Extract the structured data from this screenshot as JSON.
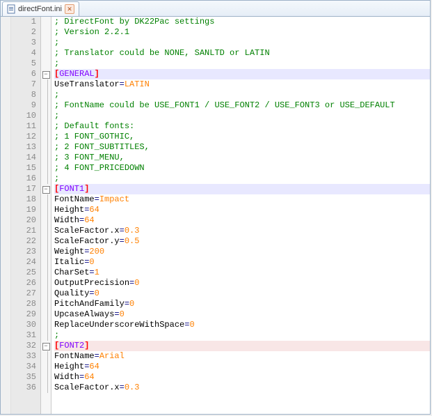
{
  "tab": {
    "filename": "directFont.ini",
    "close": "✕"
  },
  "fold": {
    "minus": "−",
    "plus": "−"
  },
  "lines": [
    {
      "n": 1,
      "f": "",
      "t": "cm",
      "txt": "; DirectFont by DK22Pac settings"
    },
    {
      "n": 2,
      "f": "",
      "t": "cm",
      "txt": "; Version 2.2.1"
    },
    {
      "n": 3,
      "f": "",
      "t": "cm",
      "txt": ";"
    },
    {
      "n": 4,
      "f": "",
      "t": "cm",
      "txt": "; Translator could be NONE, SANLTD or LATIN"
    },
    {
      "n": 5,
      "f": "",
      "t": "cm",
      "txt": ";"
    },
    {
      "n": 6,
      "f": "fold",
      "hl": "hl",
      "t": "sect",
      "open": "[",
      "name": "GENERAL",
      "close": "]"
    },
    {
      "n": 7,
      "f": "v",
      "t": "kv",
      "k": "UseTranslator",
      "v": "LATIN"
    },
    {
      "n": 8,
      "f": "v",
      "t": "cm",
      "txt": ";"
    },
    {
      "n": 9,
      "f": "v",
      "t": "cm",
      "txt": "; FontName could be USE_FONT1 / USE_FONT2 / USE_FONT3 or USE_DEFAULT"
    },
    {
      "n": 10,
      "f": "v",
      "t": "cm",
      "txt": ";"
    },
    {
      "n": 11,
      "f": "v",
      "t": "cm",
      "txt": "; Default fonts:"
    },
    {
      "n": 12,
      "f": "v",
      "t": "cm",
      "txt": "; 1 FONT_GOTHIC,"
    },
    {
      "n": 13,
      "f": "v",
      "t": "cm",
      "txt": "; 2 FONT_SUBTITLES,"
    },
    {
      "n": 14,
      "f": "v",
      "t": "cm",
      "txt": "; 3 FONT_MENU,"
    },
    {
      "n": 15,
      "f": "v",
      "t": "cm",
      "txt": "; 4 FONT_PRICEDOWN"
    },
    {
      "n": 16,
      "f": "v",
      "t": "cm",
      "txt": ";"
    },
    {
      "n": 17,
      "f": "fold",
      "hl": "hl",
      "t": "sect",
      "open": "[",
      "name": "FONT1",
      "close": "]"
    },
    {
      "n": 18,
      "f": "v",
      "t": "kv",
      "k": "FontName",
      "v": "Impact"
    },
    {
      "n": 19,
      "f": "v",
      "t": "kv",
      "k": "Height",
      "v": "64"
    },
    {
      "n": 20,
      "f": "v",
      "t": "kv",
      "k": "Width",
      "v": "64"
    },
    {
      "n": 21,
      "f": "v",
      "t": "kv",
      "k": "ScaleFactor.x",
      "v": "0.3"
    },
    {
      "n": 22,
      "f": "v",
      "t": "kv",
      "k": "ScaleFactor.y",
      "v": "0.5"
    },
    {
      "n": 23,
      "f": "v",
      "t": "kv",
      "k": "Weight",
      "v": "200"
    },
    {
      "n": 24,
      "f": "v",
      "t": "kv",
      "k": "Italic",
      "v": "0"
    },
    {
      "n": 25,
      "f": "v",
      "t": "kv",
      "k": "CharSet",
      "v": "1"
    },
    {
      "n": 26,
      "f": "v",
      "t": "kv",
      "k": "OutputPrecision",
      "v": "0"
    },
    {
      "n": 27,
      "f": "v",
      "t": "kv",
      "k": "Quality",
      "v": "0"
    },
    {
      "n": 28,
      "f": "v",
      "t": "kv",
      "k": "PitchAndFamily",
      "v": "0"
    },
    {
      "n": 29,
      "f": "v",
      "t": "kv",
      "k": "UpcaseAlways",
      "v": "0"
    },
    {
      "n": 30,
      "f": "v",
      "t": "kv",
      "k": "ReplaceUnderscoreWithSpace",
      "v": "0"
    },
    {
      "n": 31,
      "f": "v",
      "t": "cm",
      "txt": ";"
    },
    {
      "n": 32,
      "f": "fold",
      "hl": "hlr",
      "t": "sect",
      "open": "[",
      "name": "FONT2",
      "close": "]"
    },
    {
      "n": 33,
      "f": "v",
      "t": "kv",
      "k": "FontName",
      "v": "Arial"
    },
    {
      "n": 34,
      "f": "v",
      "t": "kv",
      "k": "Height",
      "v": "64"
    },
    {
      "n": 35,
      "f": "v",
      "t": "kv",
      "k": "Width",
      "v": "64"
    },
    {
      "n": 36,
      "f": "v",
      "t": "kv",
      "k": "ScaleFactor.x",
      "v": "0.3"
    }
  ]
}
